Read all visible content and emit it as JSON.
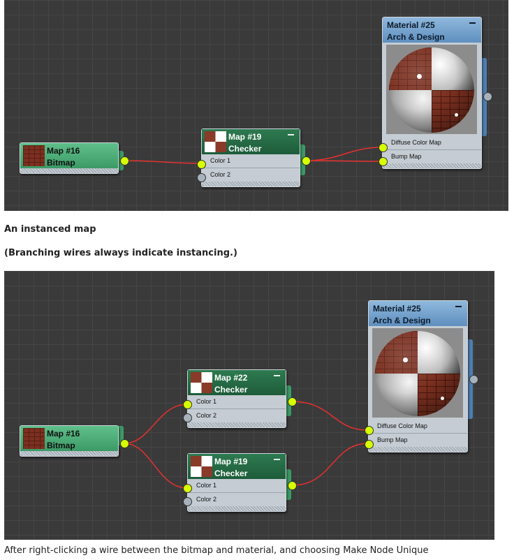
{
  "diagram1": {
    "bitmap": {
      "name": "Map #16",
      "type": "Bitmap"
    },
    "checker": {
      "name": "Map #19",
      "type": "Checker",
      "slots": [
        "Color 1",
        "Color 2"
      ]
    },
    "material": {
      "name": "Material #25",
      "type": "Arch & Design",
      "slots": [
        "Diffuse Color Map",
        "Bump Map"
      ]
    }
  },
  "caption1": "An instanced map",
  "caption2": "(Branching wires always indicate instancing.)",
  "diagram2": {
    "bitmap": {
      "name": "Map #16",
      "type": "Bitmap"
    },
    "checker_top": {
      "name": "Map #22",
      "type": "Checker",
      "slots": [
        "Color 1",
        "Color 2"
      ]
    },
    "checker_bottom": {
      "name": "Map #19",
      "type": "Checker",
      "slots": [
        "Color 1",
        "Color 2"
      ]
    },
    "material": {
      "name": "Material #25",
      "type": "Arch & Design",
      "slots": [
        "Diffuse Color Map",
        "Bump Map"
      ]
    }
  },
  "caption3": "After right-clicking a wire between the bitmap and material, and choosing Make Node Unique",
  "colors": {
    "wire": "#e63030",
    "port_connected": "#d7ff00",
    "port_empty": "#a6b1bc",
    "view_background": "#3a3a3a",
    "bitmap_header": "#3c9a66",
    "checker_header": "#1e5c3a",
    "material_header": "#5f8fbf"
  }
}
